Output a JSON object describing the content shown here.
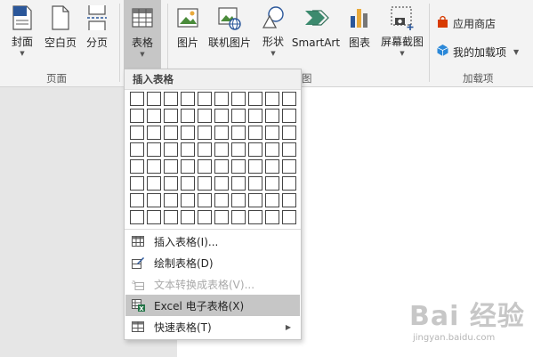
{
  "ribbon": {
    "page_group": {
      "label": "页面",
      "buttons": [
        {
          "label": "封面",
          "icon": "cover-page-icon",
          "has_arrow": true
        },
        {
          "label": "空白页",
          "icon": "blank-page-icon"
        },
        {
          "label": "分页",
          "icon": "page-break-icon"
        }
      ]
    },
    "table_button": {
      "label": "表格",
      "icon": "table-icon"
    },
    "illustrations_group": {
      "label_visible": "图",
      "buttons": [
        {
          "label": "图片",
          "icon": "picture-icon"
        },
        {
          "label": "联机图片",
          "icon": "online-picture-icon"
        },
        {
          "label": "形状",
          "icon": "shapes-icon"
        },
        {
          "label": "SmartArt",
          "icon": "smartart-icon"
        },
        {
          "label": "图表",
          "icon": "chart-icon"
        },
        {
          "label": "屏幕截图",
          "icon": "screenshot-icon"
        }
      ]
    },
    "addins_group": {
      "label": "加载项",
      "store": {
        "label": "应用商店",
        "icon": "store-icon"
      },
      "my_addins": {
        "label": "我的加载项",
        "icon": "my-addins-icon"
      }
    }
  },
  "table_menu": {
    "header": "插入表格",
    "grid": {
      "columns": 10,
      "rows": 8
    },
    "items": [
      {
        "label": "插入表格(I)...",
        "icon": "insert-table-icon",
        "enabled": true
      },
      {
        "label": "绘制表格(D)",
        "icon": "draw-table-icon",
        "enabled": true
      },
      {
        "label": "文本转换成表格(V)...",
        "icon": "convert-text-icon",
        "enabled": false
      },
      {
        "label": "Excel 电子表格(X)",
        "icon": "excel-sheet-icon",
        "enabled": true,
        "highlighted": true
      },
      {
        "label": "快速表格(T)",
        "icon": "quick-table-icon",
        "enabled": true,
        "has_submenu": true
      }
    ]
  },
  "watermark": {
    "main": "Bai 经验",
    "sub": "jingyan.baidu.com"
  },
  "colors": {
    "accent": "#2b579a",
    "highlight": "#c6c6c6",
    "ribbon_bg": "#f3f3f3",
    "doc_bg": "#e6e6e6"
  }
}
